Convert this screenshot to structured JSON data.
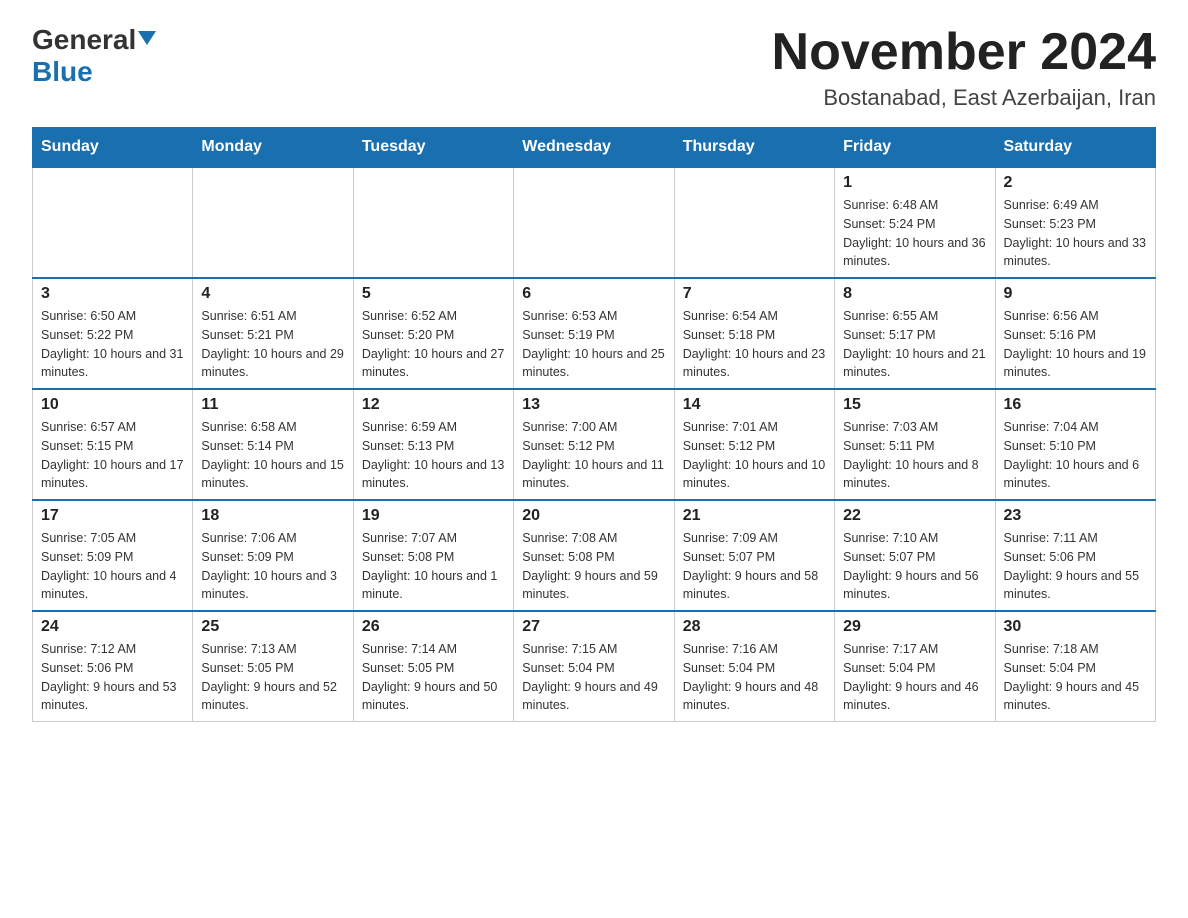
{
  "header": {
    "logo_general": "General",
    "logo_blue": "Blue",
    "month_title": "November 2024",
    "location": "Bostanabad, East Azerbaijan, Iran"
  },
  "weekdays": [
    "Sunday",
    "Monday",
    "Tuesday",
    "Wednesday",
    "Thursday",
    "Friday",
    "Saturday"
  ],
  "weeks": [
    [
      {
        "day": "",
        "sunrise": "",
        "sunset": "",
        "daylight": ""
      },
      {
        "day": "",
        "sunrise": "",
        "sunset": "",
        "daylight": ""
      },
      {
        "day": "",
        "sunrise": "",
        "sunset": "",
        "daylight": ""
      },
      {
        "day": "",
        "sunrise": "",
        "sunset": "",
        "daylight": ""
      },
      {
        "day": "",
        "sunrise": "",
        "sunset": "",
        "daylight": ""
      },
      {
        "day": "1",
        "sunrise": "Sunrise: 6:48 AM",
        "sunset": "Sunset: 5:24 PM",
        "daylight": "Daylight: 10 hours and 36 minutes."
      },
      {
        "day": "2",
        "sunrise": "Sunrise: 6:49 AM",
        "sunset": "Sunset: 5:23 PM",
        "daylight": "Daylight: 10 hours and 33 minutes."
      }
    ],
    [
      {
        "day": "3",
        "sunrise": "Sunrise: 6:50 AM",
        "sunset": "Sunset: 5:22 PM",
        "daylight": "Daylight: 10 hours and 31 minutes."
      },
      {
        "day": "4",
        "sunrise": "Sunrise: 6:51 AM",
        "sunset": "Sunset: 5:21 PM",
        "daylight": "Daylight: 10 hours and 29 minutes."
      },
      {
        "day": "5",
        "sunrise": "Sunrise: 6:52 AM",
        "sunset": "Sunset: 5:20 PM",
        "daylight": "Daylight: 10 hours and 27 minutes."
      },
      {
        "day": "6",
        "sunrise": "Sunrise: 6:53 AM",
        "sunset": "Sunset: 5:19 PM",
        "daylight": "Daylight: 10 hours and 25 minutes."
      },
      {
        "day": "7",
        "sunrise": "Sunrise: 6:54 AM",
        "sunset": "Sunset: 5:18 PM",
        "daylight": "Daylight: 10 hours and 23 minutes."
      },
      {
        "day": "8",
        "sunrise": "Sunrise: 6:55 AM",
        "sunset": "Sunset: 5:17 PM",
        "daylight": "Daylight: 10 hours and 21 minutes."
      },
      {
        "day": "9",
        "sunrise": "Sunrise: 6:56 AM",
        "sunset": "Sunset: 5:16 PM",
        "daylight": "Daylight: 10 hours and 19 minutes."
      }
    ],
    [
      {
        "day": "10",
        "sunrise": "Sunrise: 6:57 AM",
        "sunset": "Sunset: 5:15 PM",
        "daylight": "Daylight: 10 hours and 17 minutes."
      },
      {
        "day": "11",
        "sunrise": "Sunrise: 6:58 AM",
        "sunset": "Sunset: 5:14 PM",
        "daylight": "Daylight: 10 hours and 15 minutes."
      },
      {
        "day": "12",
        "sunrise": "Sunrise: 6:59 AM",
        "sunset": "Sunset: 5:13 PM",
        "daylight": "Daylight: 10 hours and 13 minutes."
      },
      {
        "day": "13",
        "sunrise": "Sunrise: 7:00 AM",
        "sunset": "Sunset: 5:12 PM",
        "daylight": "Daylight: 10 hours and 11 minutes."
      },
      {
        "day": "14",
        "sunrise": "Sunrise: 7:01 AM",
        "sunset": "Sunset: 5:12 PM",
        "daylight": "Daylight: 10 hours and 10 minutes."
      },
      {
        "day": "15",
        "sunrise": "Sunrise: 7:03 AM",
        "sunset": "Sunset: 5:11 PM",
        "daylight": "Daylight: 10 hours and 8 minutes."
      },
      {
        "day": "16",
        "sunrise": "Sunrise: 7:04 AM",
        "sunset": "Sunset: 5:10 PM",
        "daylight": "Daylight: 10 hours and 6 minutes."
      }
    ],
    [
      {
        "day": "17",
        "sunrise": "Sunrise: 7:05 AM",
        "sunset": "Sunset: 5:09 PM",
        "daylight": "Daylight: 10 hours and 4 minutes."
      },
      {
        "day": "18",
        "sunrise": "Sunrise: 7:06 AM",
        "sunset": "Sunset: 5:09 PM",
        "daylight": "Daylight: 10 hours and 3 minutes."
      },
      {
        "day": "19",
        "sunrise": "Sunrise: 7:07 AM",
        "sunset": "Sunset: 5:08 PM",
        "daylight": "Daylight: 10 hours and 1 minute."
      },
      {
        "day": "20",
        "sunrise": "Sunrise: 7:08 AM",
        "sunset": "Sunset: 5:08 PM",
        "daylight": "Daylight: 9 hours and 59 minutes."
      },
      {
        "day": "21",
        "sunrise": "Sunrise: 7:09 AM",
        "sunset": "Sunset: 5:07 PM",
        "daylight": "Daylight: 9 hours and 58 minutes."
      },
      {
        "day": "22",
        "sunrise": "Sunrise: 7:10 AM",
        "sunset": "Sunset: 5:07 PM",
        "daylight": "Daylight: 9 hours and 56 minutes."
      },
      {
        "day": "23",
        "sunrise": "Sunrise: 7:11 AM",
        "sunset": "Sunset: 5:06 PM",
        "daylight": "Daylight: 9 hours and 55 minutes."
      }
    ],
    [
      {
        "day": "24",
        "sunrise": "Sunrise: 7:12 AM",
        "sunset": "Sunset: 5:06 PM",
        "daylight": "Daylight: 9 hours and 53 minutes."
      },
      {
        "day": "25",
        "sunrise": "Sunrise: 7:13 AM",
        "sunset": "Sunset: 5:05 PM",
        "daylight": "Daylight: 9 hours and 52 minutes."
      },
      {
        "day": "26",
        "sunrise": "Sunrise: 7:14 AM",
        "sunset": "Sunset: 5:05 PM",
        "daylight": "Daylight: 9 hours and 50 minutes."
      },
      {
        "day": "27",
        "sunrise": "Sunrise: 7:15 AM",
        "sunset": "Sunset: 5:04 PM",
        "daylight": "Daylight: 9 hours and 49 minutes."
      },
      {
        "day": "28",
        "sunrise": "Sunrise: 7:16 AM",
        "sunset": "Sunset: 5:04 PM",
        "daylight": "Daylight: 9 hours and 48 minutes."
      },
      {
        "day": "29",
        "sunrise": "Sunrise: 7:17 AM",
        "sunset": "Sunset: 5:04 PM",
        "daylight": "Daylight: 9 hours and 46 minutes."
      },
      {
        "day": "30",
        "sunrise": "Sunrise: 7:18 AM",
        "sunset": "Sunset: 5:04 PM",
        "daylight": "Daylight: 9 hours and 45 minutes."
      }
    ]
  ]
}
